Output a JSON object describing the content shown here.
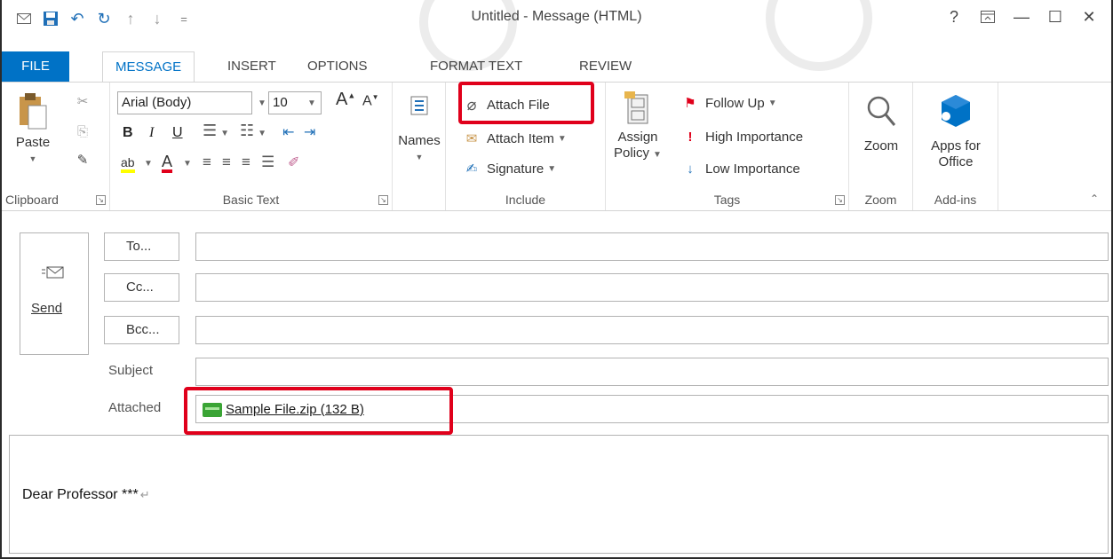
{
  "window": {
    "title": "Untitled - Message (HTML)",
    "controls": {
      "help": "?",
      "ribbon_display": "⌃",
      "minimize": "—",
      "maximize": "☐",
      "close": "✕"
    }
  },
  "qat": {
    "icons": [
      "envelope-icon",
      "save-icon",
      "undo-icon",
      "redo-icon",
      "up-icon",
      "down-icon",
      "customize-icon"
    ]
  },
  "tabs": [
    "FILE",
    "MESSAGE",
    "INSERT",
    "OPTIONS",
    "FORMAT TEXT",
    "REVIEW"
  ],
  "ribbon": {
    "clipboard": {
      "label": "Clipboard",
      "paste": "Paste"
    },
    "basic_text": {
      "label": "Basic Text",
      "font": "Arial (Body)",
      "size": "10"
    },
    "names": {
      "label": "Names"
    },
    "include": {
      "label": "Include",
      "attach_file": "Attach File",
      "attach_item": "Attach Item",
      "signature": "Signature"
    },
    "tags": {
      "label": "Tags",
      "assign": "Assign",
      "policy": "Policy",
      "follow_up": "Follow Up",
      "high": "High Importance",
      "low": "Low Importance"
    },
    "zoom": {
      "label": "Zoom",
      "button": "Zoom"
    },
    "addins": {
      "label": "Add-ins",
      "apps_line1": "Apps for",
      "apps_line2": "Office"
    }
  },
  "form": {
    "send": "Send",
    "to": "To...",
    "cc": "Cc...",
    "bcc": "Bcc...",
    "subject_label": "Subject",
    "attached_label": "Attached",
    "attachment": "Sample File.zip (132 B)"
  },
  "body": {
    "text": "Dear Professor ***"
  },
  "colors": {
    "accent": "#0072c6",
    "highlight": "#e0001b"
  }
}
